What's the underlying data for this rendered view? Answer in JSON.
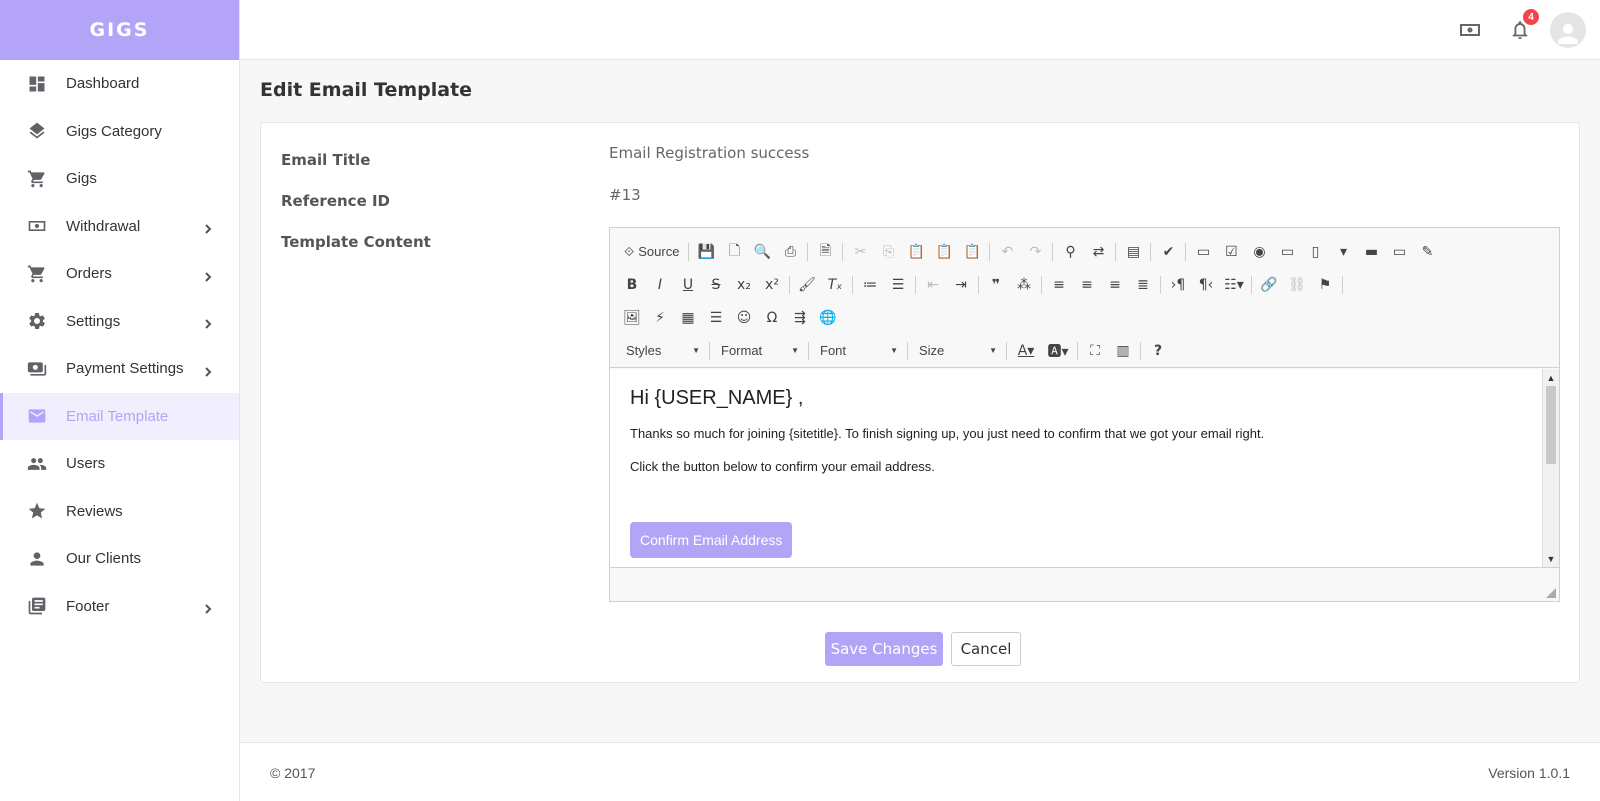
{
  "brand": "GIGS",
  "sidebar": {
    "items": [
      {
        "label": "Dashboard"
      },
      {
        "label": "Gigs Category"
      },
      {
        "label": "Gigs"
      },
      {
        "label": "Withdrawal"
      },
      {
        "label": "Orders"
      },
      {
        "label": "Settings"
      },
      {
        "label": "Payment Settings"
      },
      {
        "label": "Email Template"
      },
      {
        "label": "Users"
      },
      {
        "label": "Reviews"
      },
      {
        "label": "Our Clients"
      },
      {
        "label": "Footer"
      }
    ]
  },
  "header": {
    "notification_count": "4",
    "icons": [
      "money-icon",
      "bell-icon",
      "user-avatar"
    ]
  },
  "page_title": "Edit Email Template",
  "form": {
    "email_title_label": "Email Title",
    "email_title_value": "Email Registration success",
    "reference_id_label": "Reference ID",
    "reference_id_value": "#13",
    "template_content_label": "Template Content"
  },
  "editor": {
    "source_label": "Source",
    "combos": {
      "styles": "Styles",
      "format": "Format",
      "font": "Font",
      "size": "Size"
    },
    "content": {
      "greeting": "Hi {USER_NAME} ,",
      "paragraph1": "Thanks so much for joining {sitetitle}. To finish signing up, you just need to confirm that we got your email right.",
      "paragraph2": "Click the button below to confirm your email address.",
      "button": "Confirm Email Address"
    }
  },
  "buttons": {
    "save": "Save Changes",
    "cancel": "Cancel"
  },
  "footer": {
    "copyright": "© 2017",
    "version": "Version 1.0.1"
  },
  "colors": {
    "accent": "#b4a4f7",
    "badge": "#f0454a"
  }
}
